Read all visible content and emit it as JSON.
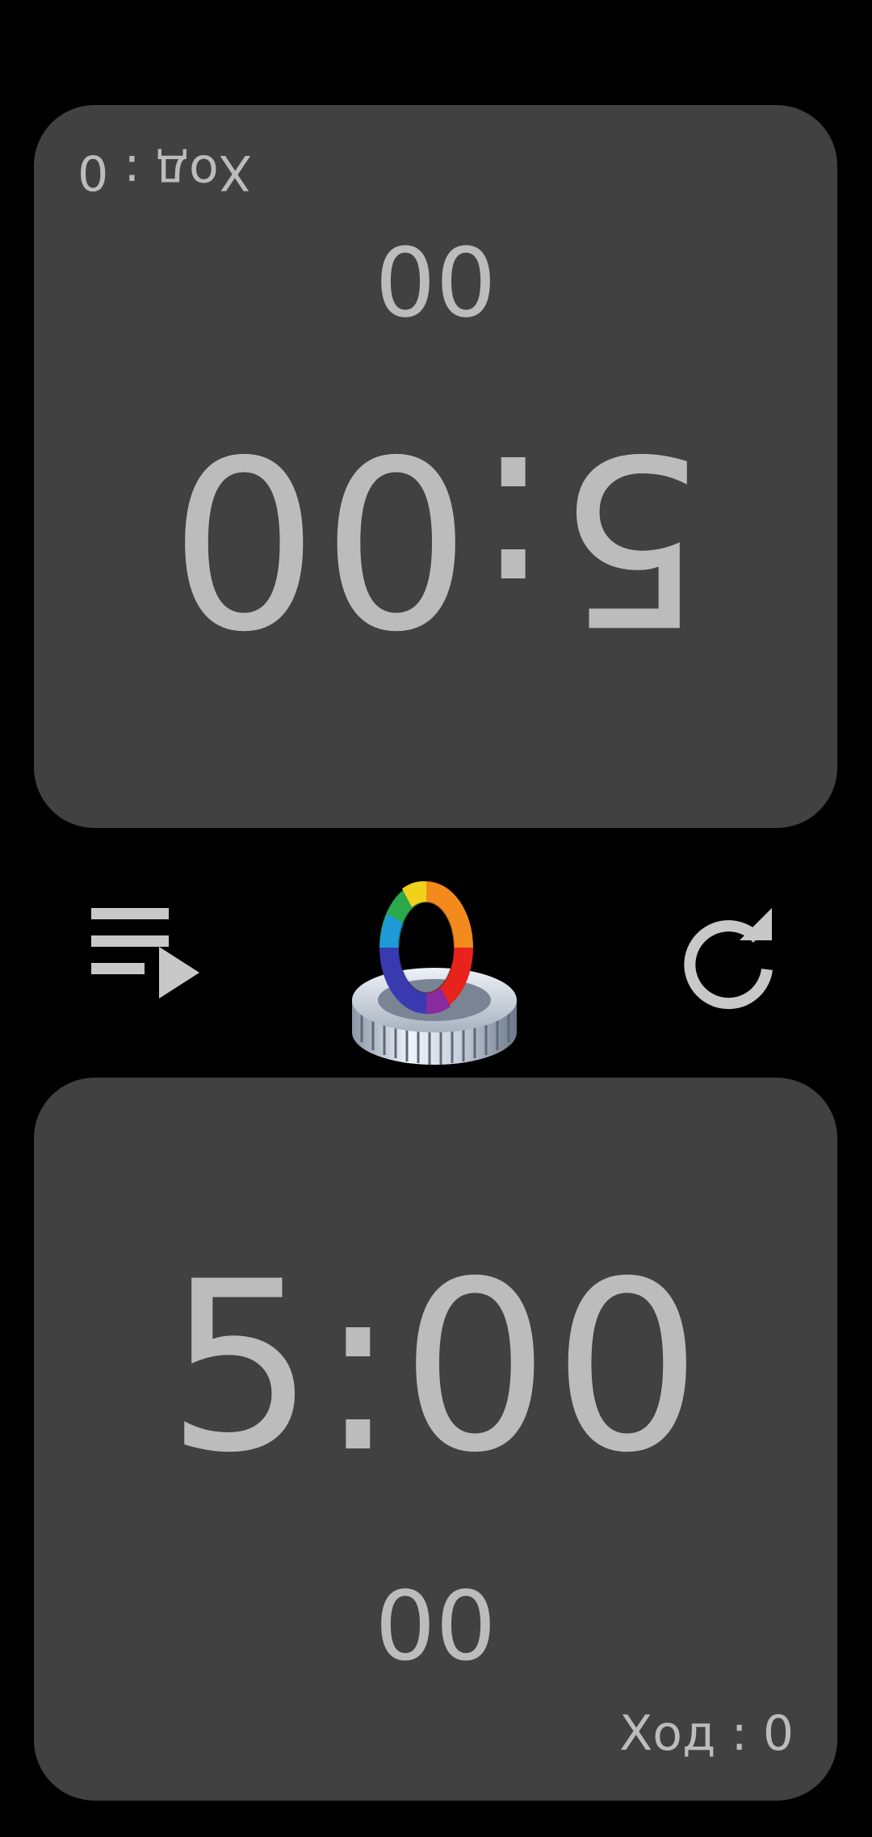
{
  "top_player": {
    "main_time": "5:00",
    "sub_time": "00",
    "move_label": "Ход : 0"
  },
  "bottom_player": {
    "main_time": "5:00",
    "sub_time": "00",
    "move_label": "Ход : 0"
  },
  "controls": {
    "left_icon": "playlist-play-icon",
    "center_icon": "color-gear-settings-icon",
    "right_icon": "refresh-icon"
  },
  "colors": {
    "background": "#000000",
    "panel": "#414141",
    "text": "#bcbcbc"
  }
}
